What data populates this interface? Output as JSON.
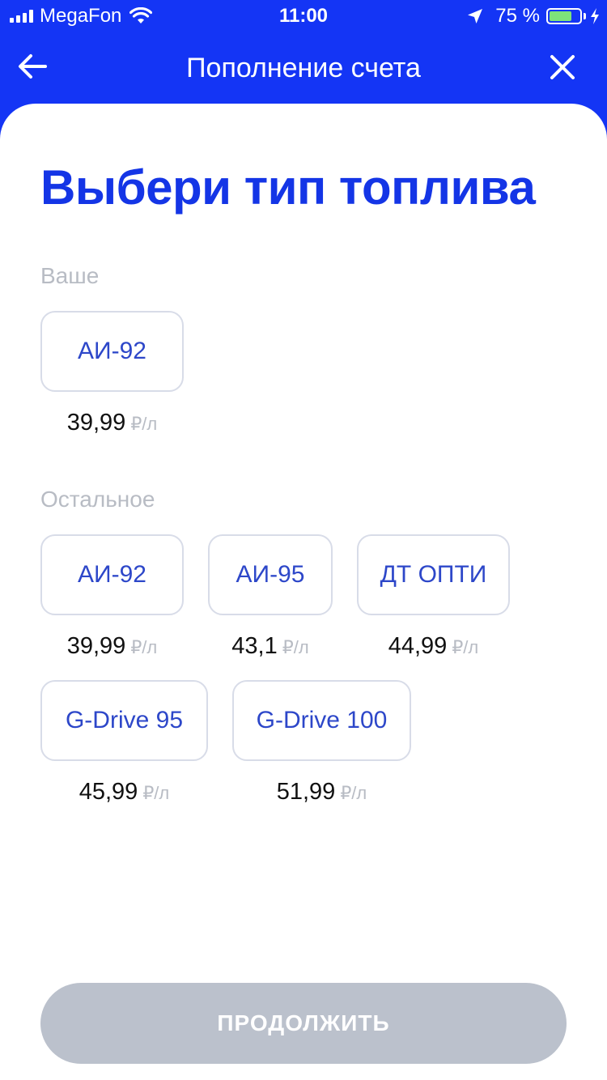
{
  "status_bar": {
    "carrier": "MegaFon",
    "time": "11:00",
    "battery_percent": "75 %",
    "battery_level": 0.75,
    "icons": [
      "signal-icon",
      "wifi-icon",
      "location-arrow-icon",
      "battery-icon",
      "charging-bolt-icon"
    ]
  },
  "nav": {
    "title": "Пополнение счета",
    "back_icon": "back-arrow-icon",
    "close_icon": "close-icon"
  },
  "main": {
    "heading": "Выбери тип топлива",
    "sections": [
      {
        "label": "Ваше",
        "items": [
          {
            "name": "АИ-92",
            "price": "39,99",
            "unit": "₽/л"
          }
        ]
      },
      {
        "label": "Остальное",
        "items": [
          {
            "name": "АИ-92",
            "price": "39,99",
            "unit": "₽/л"
          },
          {
            "name": "АИ-95",
            "price": "43,1",
            "unit": "₽/л"
          },
          {
            "name": "ДТ ОПТИ",
            "price": "44,99",
            "unit": "₽/л"
          },
          {
            "name": "G-Drive 95",
            "price": "45,99",
            "unit": "₽/л"
          },
          {
            "name": "G-Drive 100",
            "price": "51,99",
            "unit": "₽/л"
          }
        ]
      }
    ]
  },
  "footer": {
    "continue_label": "ПРОДОЛЖИТЬ"
  },
  "colors": {
    "accent": "#1435f5",
    "heading": "#1435e6",
    "card_text": "#2d47c9",
    "muted": "#b8bcc4",
    "button_disabled": "#bbc1cc",
    "battery_fill": "#7ee37a"
  }
}
